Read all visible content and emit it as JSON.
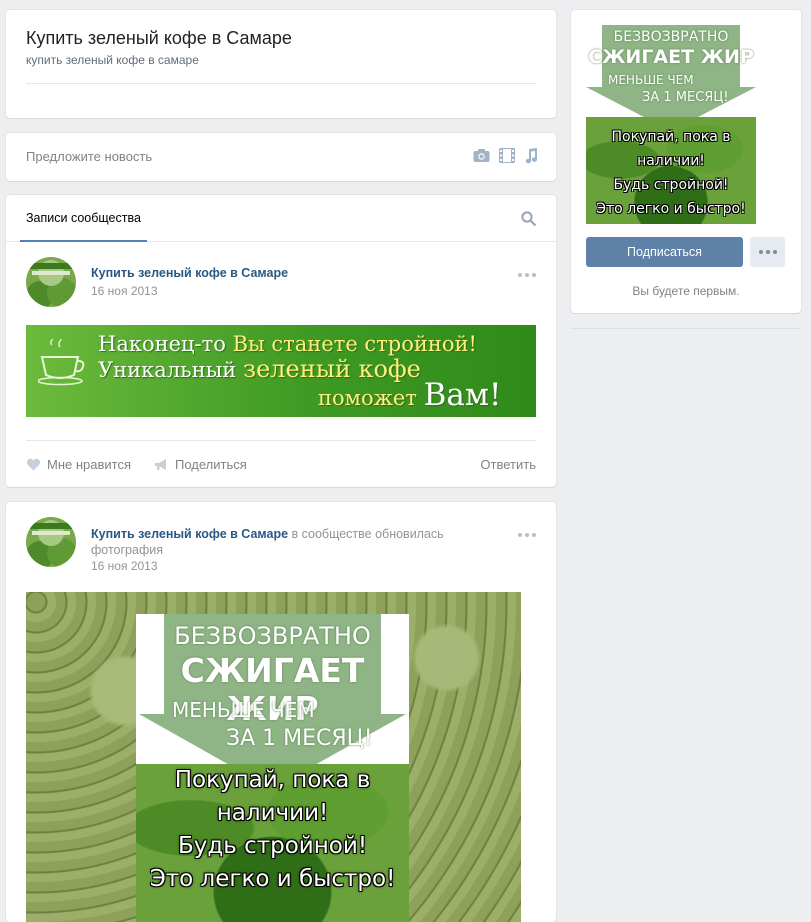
{
  "community": {
    "title": "Купить зеленый кофе в Самаре",
    "subtitle": "купить зеленый кофе в самаре"
  },
  "suggest": {
    "placeholder": "Предложите новость",
    "icons": [
      "camera-icon",
      "video-icon",
      "music-icon"
    ]
  },
  "wall": {
    "tab_label": "Записи сообщества"
  },
  "posts": [
    {
      "author": "Купить зеленый кофе в Самаре",
      "date": "16 ноя 2013",
      "banner": {
        "line1_a": "Наконец-то ",
        "line1_b": "Вы станете стройной!",
        "line2_a": "Уникальный ",
        "line2_b": "зеленый кофе",
        "line3_a": "поможет ",
        "line3_b": "Вам!"
      },
      "actions": {
        "like": "Мне нравится",
        "share": "Поделиться",
        "reply": "Ответить"
      }
    },
    {
      "author": "Купить зеленый кофе в Самаре",
      "action_text": " в сообществе обновилась фотография",
      "date": "16 ноя 2013"
    }
  ],
  "promo": {
    "line1": "БЕЗВОЗВРАТНО",
    "line2": "СЖИГАЕТ ЖИР",
    "line3": "МЕНЬШЕ ЧЕМ",
    "line4": "ЗА 1 МЕСЯЦ!",
    "line5": "Покупай, пока в",
    "line6": "наличии!",
    "line7": "Будь стройной!",
    "line8": "Это легко и быстро!"
  },
  "sidebar": {
    "subscribe_label": "Подписаться",
    "first_text": "Вы будете первым."
  },
  "colors": {
    "accent": "#5181b8",
    "button": "#5e81a8",
    "banner_green": "#3f9a24"
  }
}
